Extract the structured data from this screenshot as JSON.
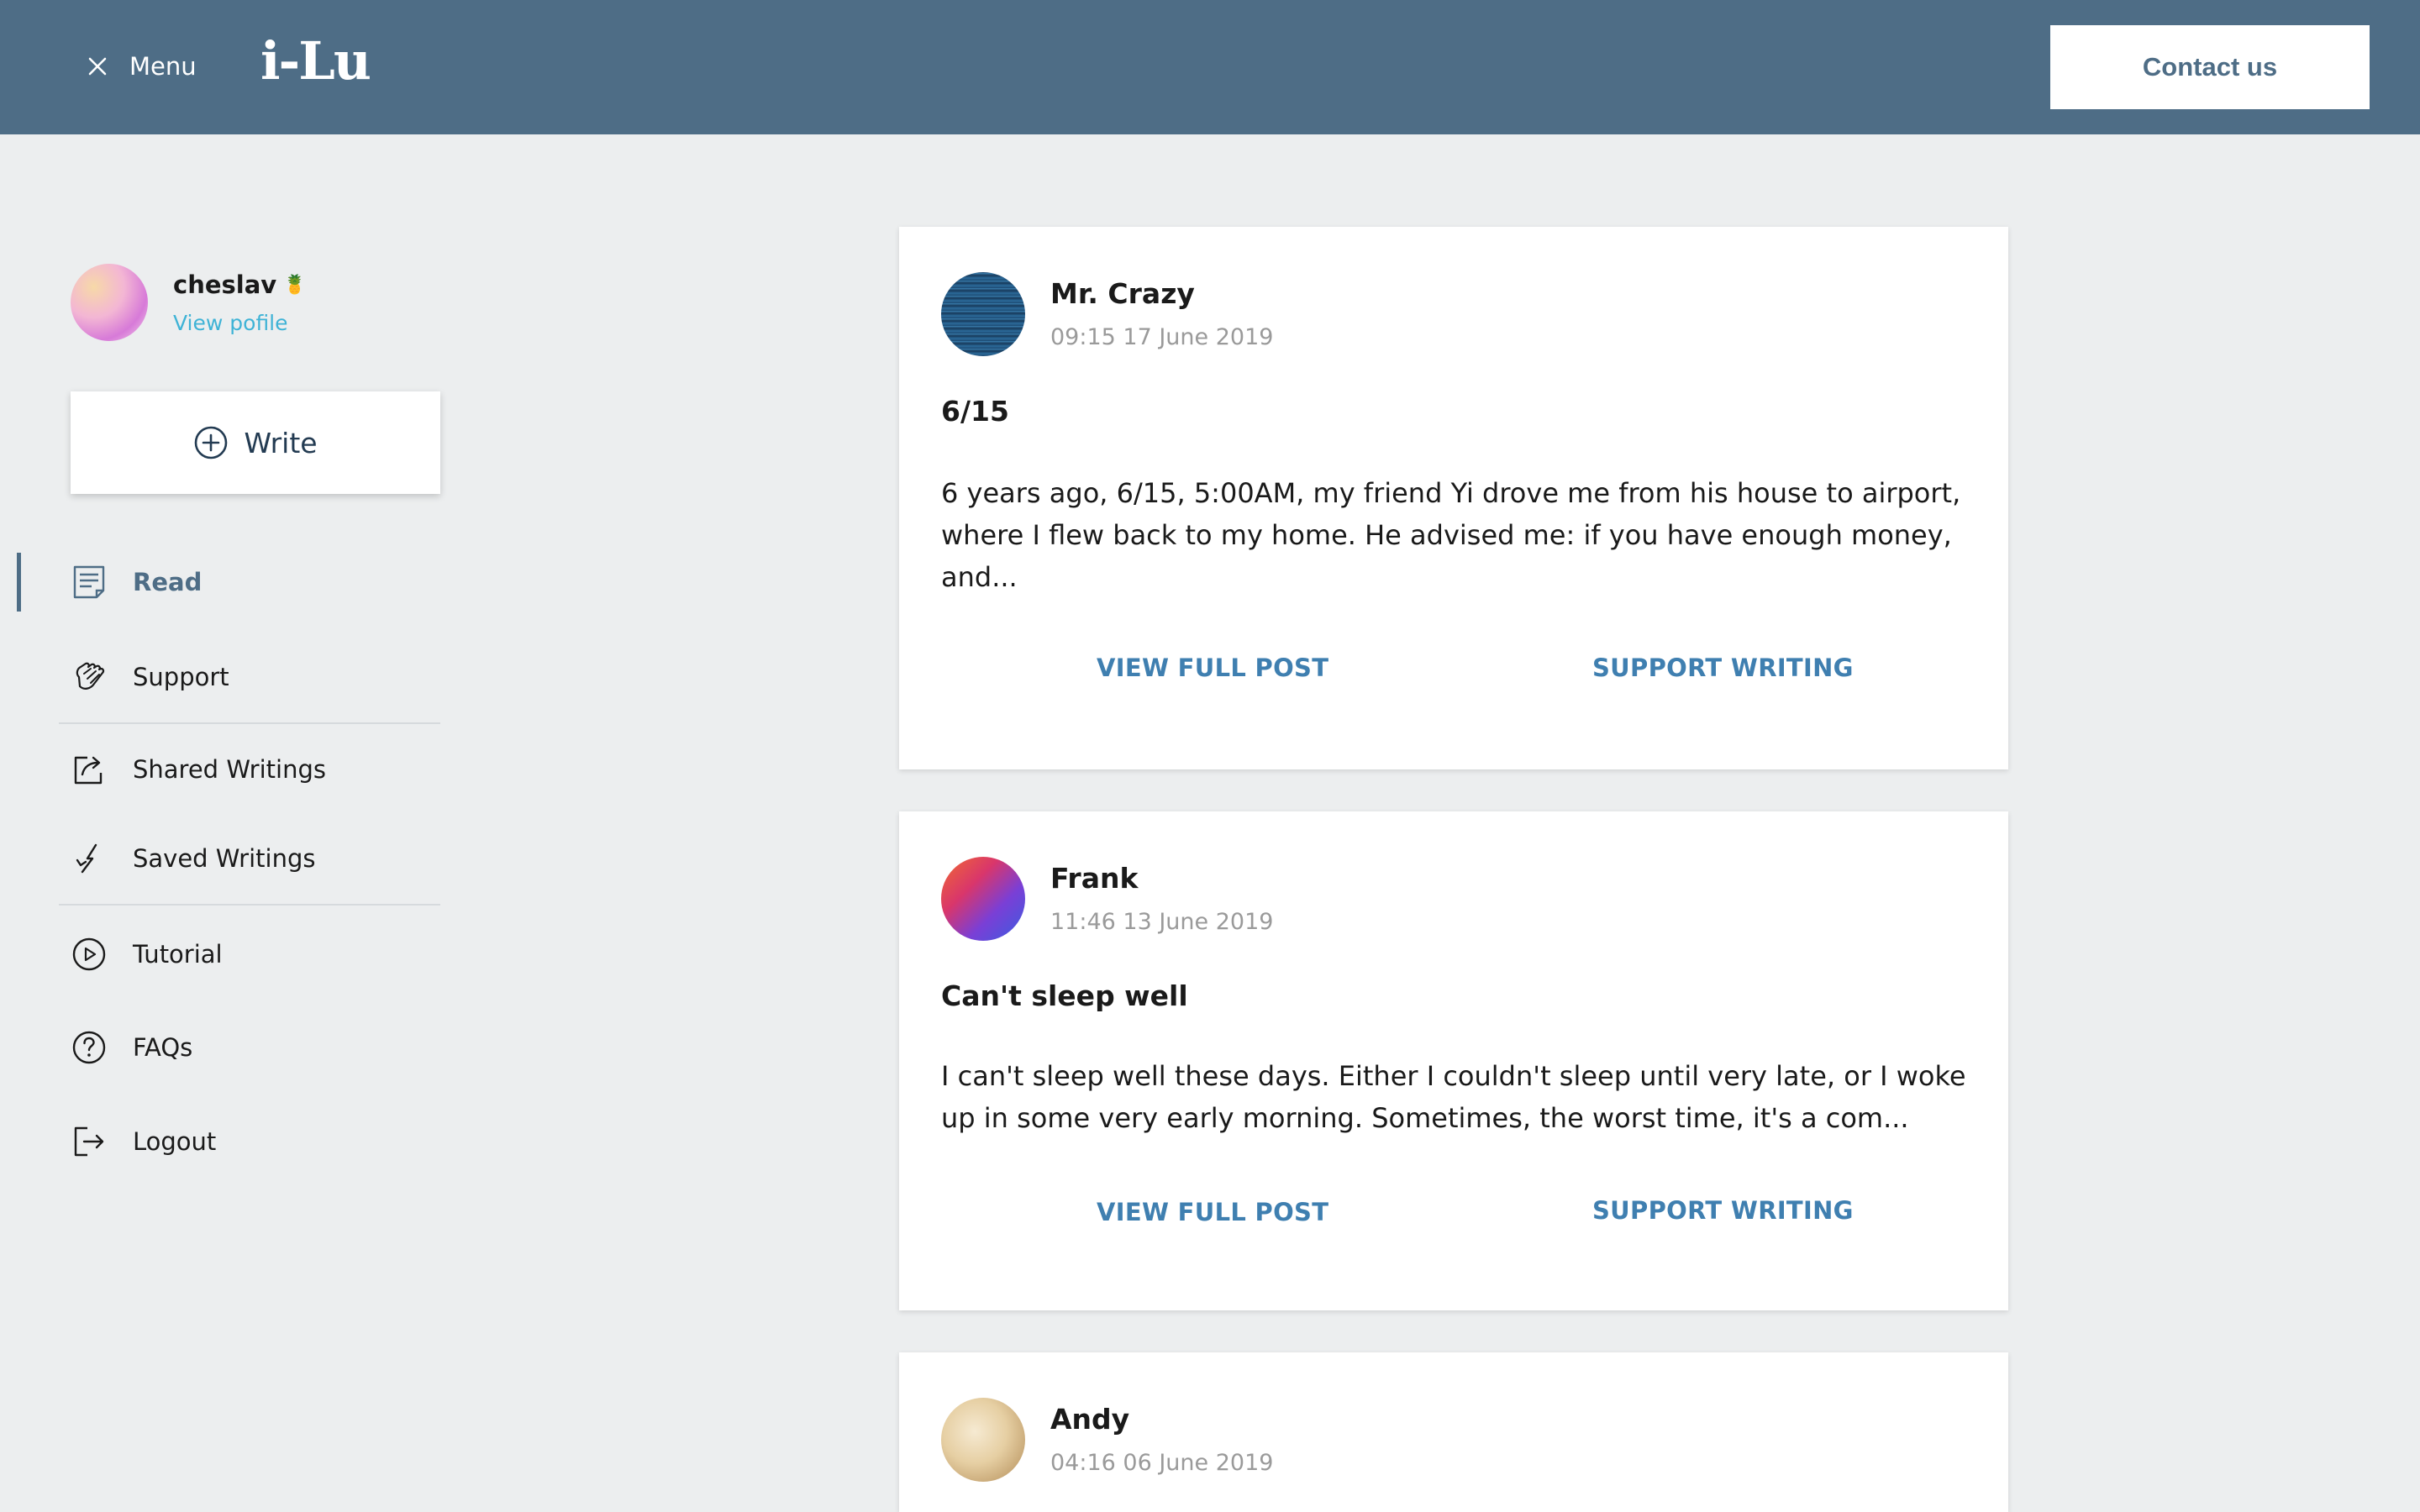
{
  "header": {
    "menu_label": "Menu",
    "logo_text": "i-Lu",
    "contact_label": "Contact us",
    "bg_color": "#4e6d86"
  },
  "profile": {
    "username": "cheslav",
    "badge": "🍍",
    "view_profile_label": "View pofile"
  },
  "write_button": {
    "label": "Write",
    "icon": "plus-circle-icon"
  },
  "nav": {
    "read": {
      "label": "Read",
      "icon": "document-icon",
      "active": true
    },
    "support": {
      "label": "Support",
      "icon": "clap-hands-icon"
    },
    "shared": {
      "label": "Shared Writings",
      "icon": "share-icon"
    },
    "saved": {
      "label": "Saved Writings",
      "icon": "bookmark-icon"
    },
    "tutorial": {
      "label": "Tutorial",
      "icon": "play-circle-icon"
    },
    "faqs": {
      "label": "FAQs",
      "icon": "question-circle-icon"
    },
    "logout": {
      "label": "Logout",
      "icon": "logout-icon"
    }
  },
  "posts": [
    {
      "author": "Mr. Crazy",
      "time": "09:15 17 June 2019",
      "title": "6/15",
      "excerpt": "6 years ago, 6/15, 5:00AM, my friend Yi drove me from his house to airport, where I flew back to my home. He advised me: if you have enough money, and...",
      "view_label": "VIEW FULL POST",
      "support_label": "SUPPORT WRITING"
    },
    {
      "author": "Frank",
      "time": "11:46 13 June 2019",
      "title": "Can't sleep well",
      "excerpt": "I can't sleep well these days. Either I couldn't sleep until very late, or I woke up in some very early morning. Sometimes, the worst time, it's a com...",
      "view_label": "VIEW FULL POST",
      "support_label": "SUPPORT WRITING"
    },
    {
      "author": "Andy",
      "time": "04:16 06 June 2019"
    }
  ],
  "colors": {
    "accent": "#4e6d86",
    "link": "#3f7fb0",
    "profile_link": "#3fb3d6",
    "page_bg": "#eceeef"
  }
}
